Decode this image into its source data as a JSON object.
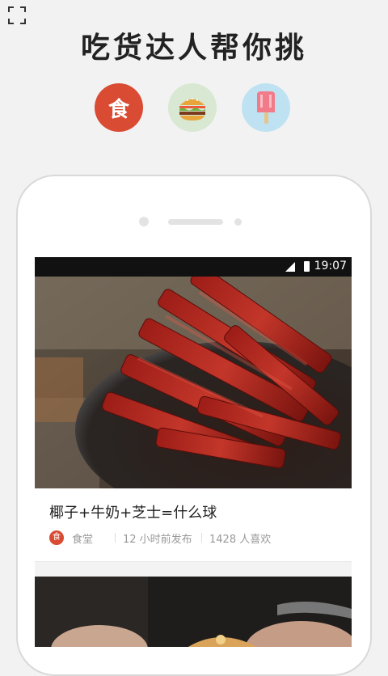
{
  "headline": "吃货达人帮你挑",
  "categories": [
    {
      "name": "food",
      "label": "食",
      "icon": "food-icon",
      "color": "#d94b33"
    },
    {
      "name": "burger",
      "icon": "burger-icon",
      "color": "#d8e8d2"
    },
    {
      "name": "popsicle",
      "icon": "popsicle-icon",
      "color": "#bfe2f2"
    }
  ],
  "status_bar": {
    "time": "19:07"
  },
  "feed": [
    {
      "title": "椰子+牛奶+芝士=什么球",
      "source_logo": "食",
      "source": "食堂",
      "time": "12 小时前发布",
      "likes": "1428 人喜欢"
    }
  ]
}
